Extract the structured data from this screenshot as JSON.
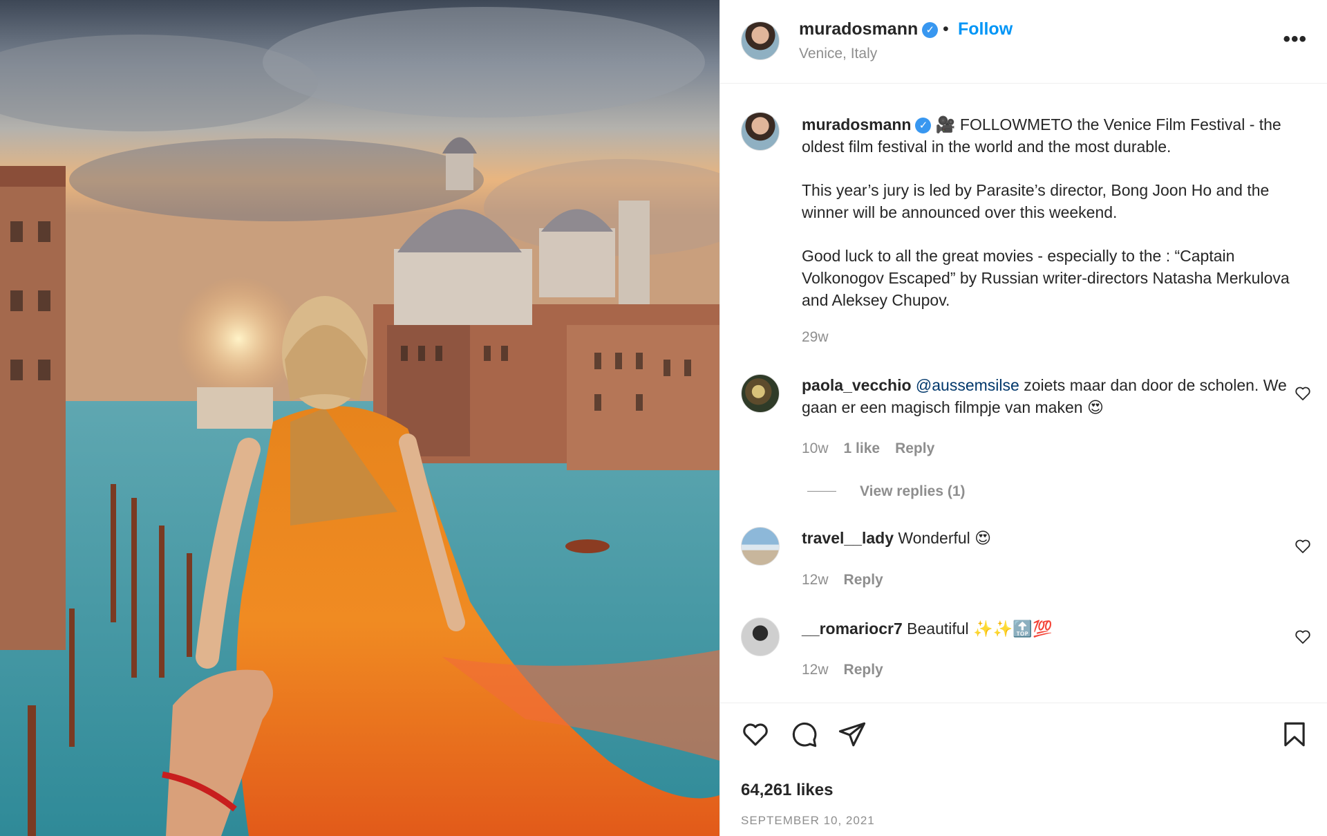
{
  "post": {
    "username": "muradosmann",
    "verified_mark": "✓",
    "separator": "•",
    "follow_label": "Follow",
    "location": "Venice, Italy",
    "more_label": "•••"
  },
  "caption": {
    "username": "muradosmann",
    "emoji": "🎥",
    "paragraph_1": "FOLLOWMETO the Venice Film Festival - the oldest film festival in the world and the most durable.",
    "paragraph_2": "This year’s jury is led by Parasite’s director, Bong Joon Ho and the winner will be announced over this weekend.",
    "paragraph_3": "Good luck to all the great movies - especially to the : “Captain Volkonogov Escaped” by Russian writer-directors Natasha Merkulova and Aleksey Chupov.",
    "time": "29w"
  },
  "comments": [
    {
      "username": "paola_vecchio",
      "mention": "@aussemsilse",
      "text": "zoiets maar dan door de scholen. We gaan er een magisch filmpje van maken 😍",
      "time": "10w",
      "likes": "1 like",
      "reply_label": "Reply",
      "view_replies": "View replies (1)"
    },
    {
      "username": "travel__lady",
      "text": "Wonderful 😍",
      "time": "12w",
      "reply_label": "Reply"
    },
    {
      "username": "__romariocr7",
      "text": "Beautiful ✨✨🔝💯",
      "time": "12w",
      "reply_label": "Reply"
    }
  ],
  "footer": {
    "likes": "64,261 likes",
    "date": "SEPTEMBER 10, 2021"
  },
  "icons": {
    "like": "heart-icon",
    "comment": "comment-icon",
    "share": "paper-plane-icon",
    "save": "bookmark-icon",
    "more": "more-icon",
    "verified": "verified-badge-icon"
  },
  "colors": {
    "accent": "#0095f6",
    "verified": "#3897f0",
    "muted": "#8e8e8e",
    "text": "#262626",
    "mention": "#00376b"
  }
}
